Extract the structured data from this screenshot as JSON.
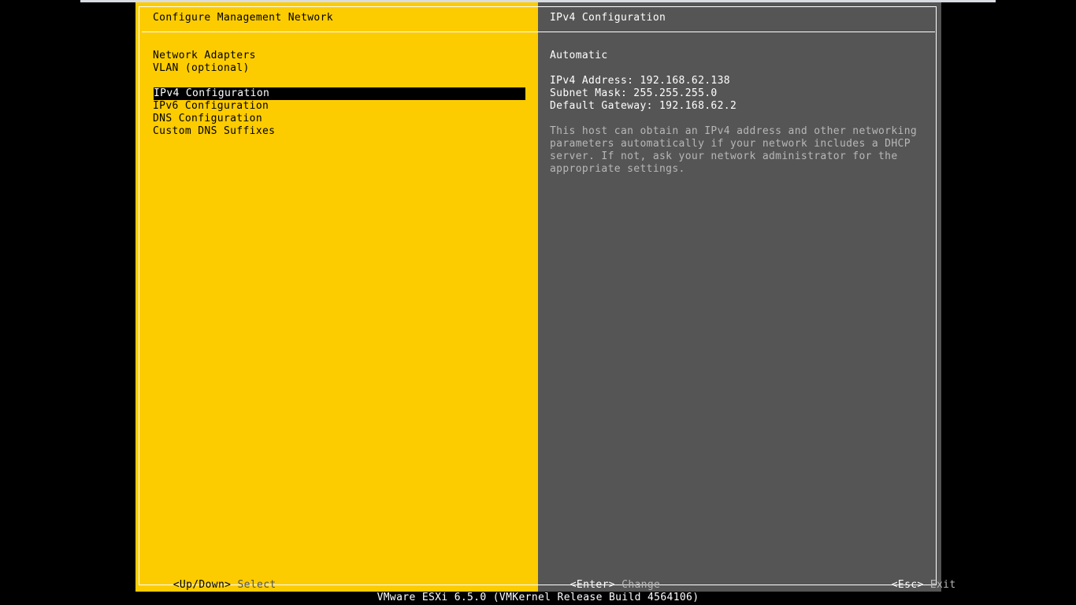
{
  "left_panel": {
    "title": "Configure Management Network",
    "menu_group_1": [
      "Network Adapters",
      "VLAN (optional)"
    ],
    "menu_group_2": [
      "IPv4 Configuration",
      "IPv6 Configuration",
      "DNS Configuration",
      "Custom DNS Suffixes"
    ],
    "selected_item": "IPv4 Configuration"
  },
  "right_panel": {
    "title": "IPv4 Configuration",
    "mode": "Automatic",
    "ipv4_address": "IPv4 Address: 192.168.62.138",
    "subnet_mask": "Subnet Mask: 255.255.255.0",
    "default_gateway": "Default Gateway: 192.168.62.2",
    "description_lines": [
      "This host can obtain an IPv4 address and other networking",
      "parameters automatically if your network includes a DHCP",
      "server. If not, ask your network administrator for the",
      "appropriate settings."
    ]
  },
  "footer": {
    "left_key": "<Up/Down>",
    "left_action": "Select",
    "mid_key": "<Enter>",
    "mid_action": "Change",
    "right_key": "<Esc>",
    "right_action": "Exit"
  },
  "status_bar": "VMware ESXi 6.5.0 (VMKernel Release Build 4564106)",
  "colors": {
    "left_bg": "#fccc00",
    "right_bg": "#555555",
    "screen_bg": "#000000"
  }
}
